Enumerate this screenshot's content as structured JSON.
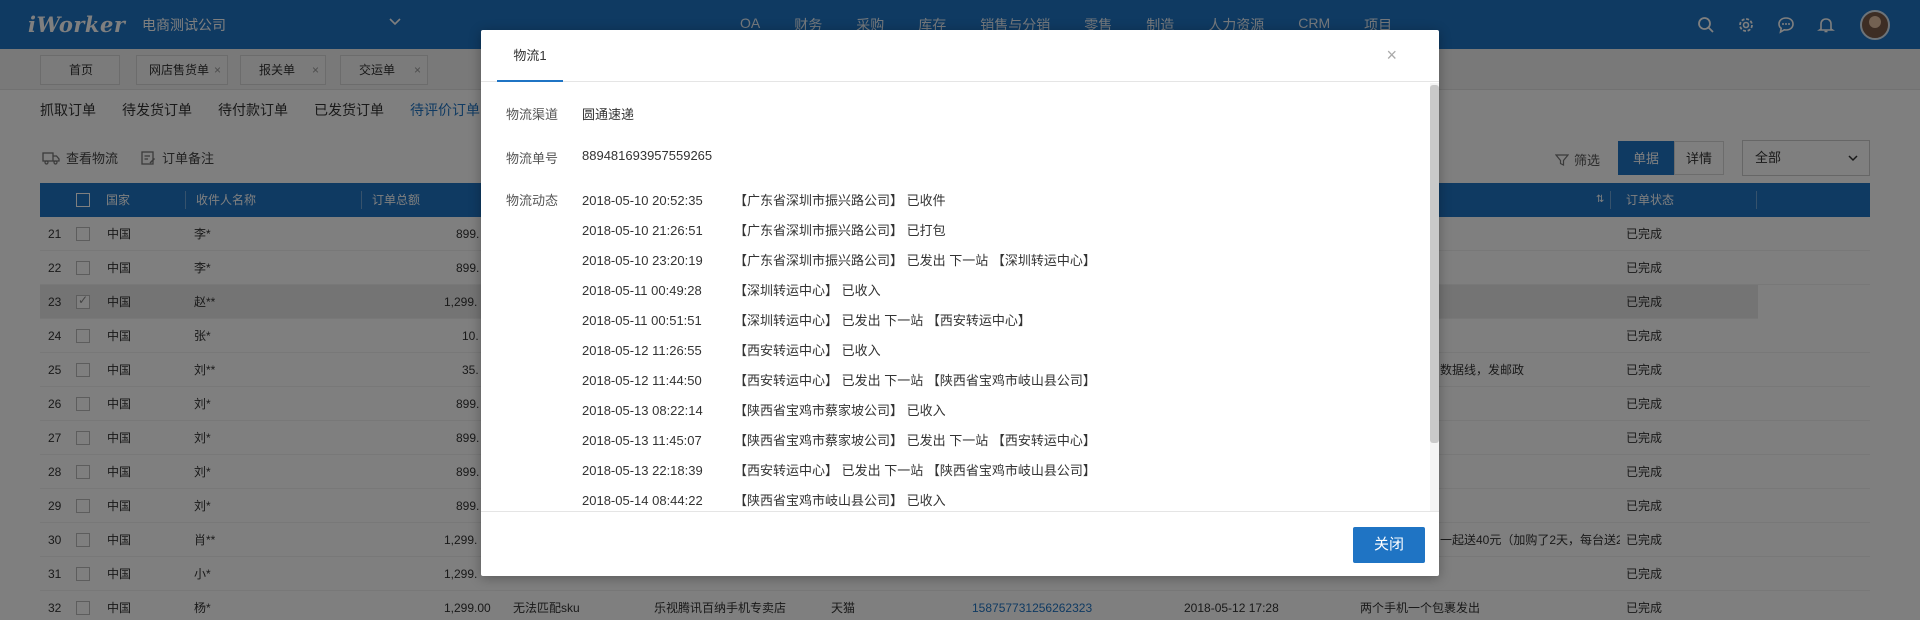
{
  "app": {
    "logo": "iWorker",
    "company": "电商测试公司"
  },
  "nav": [
    "OA",
    "财务",
    "采购",
    "库存",
    "销售与分销",
    "零售",
    "制造",
    "人力资源",
    "CRM",
    "项目"
  ],
  "top_icons": [
    "search-icon",
    "gear-icon",
    "chat-icon",
    "bell-icon"
  ],
  "page_tabs": [
    {
      "label": "首页",
      "closable": false
    },
    {
      "label": "网店售货单",
      "closable": true
    },
    {
      "label": "报关单",
      "closable": true
    },
    {
      "label": "交运单",
      "closable": true
    }
  ],
  "order_tabs": [
    "抓取订单",
    "待发货订单",
    "待付款订单",
    "已发货订单",
    "待评价订单"
  ],
  "toolbar": {
    "view_logistics": "查看物流",
    "order_note": "订单备注",
    "filter": "筛选",
    "view_list": "单据",
    "view_detail": "详情",
    "select_value": "全部"
  },
  "table": {
    "headers": [
      "国家",
      "收件人名称",
      "订单总额",
      "订单状态"
    ],
    "rows": [
      {
        "no": "21",
        "country": "中国",
        "name": "李*",
        "amount": "899.",
        "remark": "",
        "status": "已完成",
        "checked": false
      },
      {
        "no": "22",
        "country": "中国",
        "name": "李*",
        "amount": "899.",
        "remark": "",
        "status": "已完成",
        "checked": false
      },
      {
        "no": "23",
        "country": "中国",
        "name": "赵**",
        "amount": "1,299.",
        "remark": "",
        "status": "已完成",
        "checked": true
      },
      {
        "no": "24",
        "country": "中国",
        "name": "张*",
        "amount": "10.",
        "remark": "",
        "status": "已完成",
        "checked": false
      },
      {
        "no": "25",
        "country": "中国",
        "name": "刘**",
        "amount": "35.",
        "remark": "数据线，发邮政",
        "status": "已完成",
        "checked": false
      },
      {
        "no": "26",
        "country": "中国",
        "name": "刘*",
        "amount": "899.",
        "remark": "",
        "status": "已完成",
        "checked": false
      },
      {
        "no": "27",
        "country": "中国",
        "name": "刘*",
        "amount": "899.",
        "remark": "",
        "status": "已完成",
        "checked": false
      },
      {
        "no": "28",
        "country": "中国",
        "name": "刘*",
        "amount": "899.",
        "remark": "",
        "status": "已完成",
        "checked": false
      },
      {
        "no": "29",
        "country": "中国",
        "name": "刘*",
        "amount": "899.",
        "remark": "",
        "status": "已完成",
        "checked": false
      },
      {
        "no": "30",
        "country": "中国",
        "name": "肖**",
        "amount": "1,299.",
        "remark": "一起送40元（加购了2天，每台送2",
        "status": "已完成",
        "checked": false
      },
      {
        "no": "31",
        "country": "中国",
        "name": "小*",
        "amount": "1,299.",
        "remark": "",
        "status": "已完成",
        "checked": false
      },
      {
        "no": "32",
        "country": "中国",
        "name": "杨*",
        "amount": "1,299.00",
        "sku": "无法匹配sku",
        "shop": "乐视腾讯百纳手机专卖店",
        "platform": "天猫",
        "tracking": "158757731256262323",
        "date": "2018-05-12 17:28",
        "remark": "两个手机一个包裹发出",
        "status": "已完成",
        "checked": false
      }
    ]
  },
  "modal": {
    "tab": "物流1",
    "channel_label": "物流渠道",
    "channel": "圆通速递",
    "number_label": "物流单号",
    "number": "889481693957559265",
    "tracking_label": "物流动态",
    "events": [
      {
        "time": "2018-05-10 20:52:35",
        "text": "【广东省深圳市振兴路公司】 已收件"
      },
      {
        "time": "2018-05-10 21:26:51",
        "text": "【广东省深圳市振兴路公司】 已打包"
      },
      {
        "time": "2018-05-10 23:20:19",
        "text": "【广东省深圳市振兴路公司】 已发出 下一站 【深圳转运中心】"
      },
      {
        "time": "2018-05-11 00:49:28",
        "text": "【深圳转运中心】 已收入"
      },
      {
        "time": "2018-05-11 00:51:51",
        "text": "【深圳转运中心】 已发出 下一站 【西安转运中心】"
      },
      {
        "time": "2018-05-12 11:26:55",
        "text": "【西安转运中心】 已收入"
      },
      {
        "time": "2018-05-12 11:44:50",
        "text": "【西安转运中心】 已发出 下一站 【陕西省宝鸡市岐山县公司】"
      },
      {
        "time": "2018-05-13 08:22:14",
        "text": "【陕西省宝鸡市蔡家坡公司】 已收入"
      },
      {
        "time": "2018-05-13 11:45:07",
        "text": "【陕西省宝鸡市蔡家坡公司】 已发出 下一站 【西安转运中心】"
      },
      {
        "time": "2018-05-13 22:18:39",
        "text": "【西安转运中心】 已发出 下一站 【陕西省宝鸡市岐山县公司】"
      },
      {
        "time": "2018-05-14 08:44:22",
        "text": "【陕西省宝鸡市岐山县公司】 已收入"
      }
    ],
    "close_button": "关闭"
  }
}
